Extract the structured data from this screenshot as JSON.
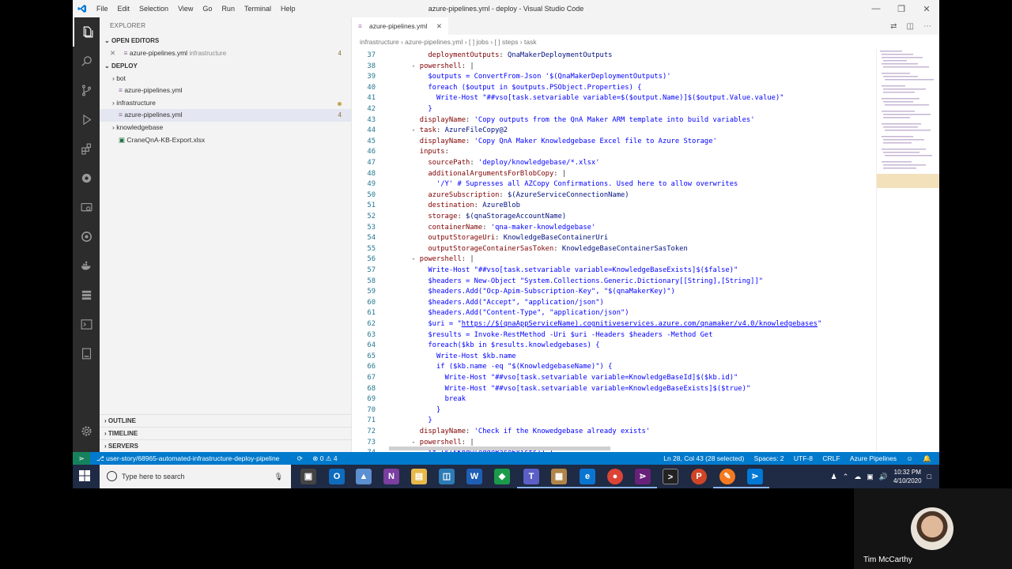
{
  "window": {
    "title": "azure-pipelines.yml - deploy - Visual Studio Code",
    "menu": [
      "File",
      "Edit",
      "Selection",
      "View",
      "Go",
      "Run",
      "Terminal",
      "Help"
    ]
  },
  "sidebar": {
    "header": "EXPLORER",
    "open_editors_label": "OPEN EDITORS",
    "open_editor": {
      "name": "azure-pipelines.yml",
      "folder": "infrastructure",
      "badge": "4"
    },
    "deploy_label": "DEPLOY",
    "tree": [
      {
        "label": "bot",
        "indent": 1,
        "kind": "folder"
      },
      {
        "label": "azure-pipelines.yml",
        "indent": 2,
        "kind": "yaml"
      },
      {
        "label": "infrastructure",
        "indent": 1,
        "kind": "folder"
      },
      {
        "label": "azure-pipelines.yml",
        "indent": 2,
        "kind": "yaml",
        "badge": "4"
      },
      {
        "label": "knowledgebase",
        "indent": 1,
        "kind": "folder"
      },
      {
        "label": "CraneQnA-KB-Export.xlsx",
        "indent": 2,
        "kind": "xlsx"
      }
    ],
    "bottom_sections": [
      "OUTLINE",
      "TIMELINE",
      "SERVERS"
    ]
  },
  "editor": {
    "tab_label": "azure-pipelines.yml",
    "breadcrumb": [
      "infrastructure",
      "azure-pipelines.yml",
      "[ ] jobs",
      "[ ] steps",
      "task"
    ],
    "lines": [
      {
        "n": "37",
        "i": "        ",
        "k": "deploymentOutputs",
        "s": ": ",
        "v": "QnaMakerDeploymentOutputs",
        "c": "t-var"
      },
      {
        "n": "38",
        "i": "    ",
        "t": "- ",
        "k": "powershell",
        "s": ": ",
        "v": "|",
        "c": "t-dark"
      },
      {
        "n": "39",
        "i": "        ",
        "v": "$outputs = ConvertFrom-Json '$(QnaMakerDeploymentOutputs)'",
        "c": "t-blue"
      },
      {
        "n": "40",
        "i": "        ",
        "v": "foreach ($output in $outputs.PSObject.Properties) {",
        "c": "t-blue"
      },
      {
        "n": "41",
        "i": "          ",
        "v": "Write-Host \"##vso[task.setvariable variable=$($output.Name)]$($output.Value.value)\"",
        "c": "t-blue"
      },
      {
        "n": "42",
        "i": "        ",
        "v": "}",
        "c": "t-blue"
      },
      {
        "n": "43",
        "i": "      ",
        "k": "displayName",
        "s": ": ",
        "v": "'Copy outputs from the QnA Maker ARM template into build variables'",
        "c": "t-blue"
      },
      {
        "n": "44",
        "i": "    ",
        "t": "- ",
        "k": "task",
        "s": ": ",
        "v": "AzureFileCopy@2",
        "c": "t-var"
      },
      {
        "n": "45",
        "i": "      ",
        "k": "displayName",
        "s": ": ",
        "v": "'Copy QnA Maker Knowledgebase Excel file to Azure Storage'",
        "c": "t-blue"
      },
      {
        "n": "46",
        "i": "      ",
        "k": "inputs",
        "s": ":",
        "v": "",
        "c": "t-blue"
      },
      {
        "n": "47",
        "i": "        ",
        "k": "sourcePath",
        "s": ": ",
        "v": "'deploy/knowledgebase/*.xlsx'",
        "c": "t-blue"
      },
      {
        "n": "48",
        "i": "        ",
        "k": "additionalArgumentsForBlobCopy",
        "s": ": ",
        "v": "|",
        "c": "t-dark"
      },
      {
        "n": "49",
        "i": "          ",
        "v": "'/Y' # Supresses all AZCopy Confirmations. Used here to allow overwrites",
        "c": "t-blue"
      },
      {
        "n": "50",
        "i": "        ",
        "k": "azureSubscription",
        "s": ": ",
        "v": "$(AzureServiceConnectionName)",
        "c": "t-var"
      },
      {
        "n": "51",
        "i": "        ",
        "k": "destination",
        "s": ": ",
        "v": "AzureBlob",
        "c": "t-var"
      },
      {
        "n": "52",
        "i": "        ",
        "k": "storage",
        "s": ": ",
        "v": "$(qnaStorageAccountName)",
        "c": "t-var"
      },
      {
        "n": "53",
        "i": "        ",
        "k": "containerName",
        "s": ": ",
        "v": "'qna-maker-knowledgebase'",
        "c": "t-blue"
      },
      {
        "n": "54",
        "i": "        ",
        "k": "outputStorageUri",
        "s": ": ",
        "v": "KnowledgeBaseContainerUri",
        "c": "t-var"
      },
      {
        "n": "55",
        "i": "        ",
        "k": "outputStorageContainerSasToken",
        "s": ": ",
        "v": "KnowledgeBaseContainerSasToken",
        "c": "t-var"
      },
      {
        "n": "56",
        "i": "    ",
        "t": "- ",
        "k": "powershell",
        "s": ": ",
        "v": "|",
        "c": "t-dark"
      },
      {
        "n": "57",
        "i": "        ",
        "v": "Write-Host \"##vso[task.setvariable variable=KnowledgeBaseExists]$($false)\"",
        "c": "t-blue"
      },
      {
        "n": "58",
        "i": "        ",
        "v": "$headers = New-Object \"System.Collections.Generic.Dictionary[[String],[String]]\"",
        "c": "t-blue"
      },
      {
        "n": "59",
        "i": "        ",
        "v": "$headers.Add(\"Ocp-Apim-Subscription-Key\", \"$(qnaMakerKey)\")",
        "c": "t-blue"
      },
      {
        "n": "60",
        "i": "        ",
        "v": "$headers.Add(\"Accept\", \"application/json\")",
        "c": "t-blue"
      },
      {
        "n": "61",
        "i": "        ",
        "v": "$headers.Add(\"Content-Type\", \"application/json\")",
        "c": "t-blue"
      },
      {
        "n": "62",
        "i": "        ",
        "v": "$uri = \"",
        "u": "https://$(qnaAppServiceName).cognitiveservices.azure.com/qnamaker/v4.0/knowledgebases",
        "e": "\"",
        "c": "t-blue"
      },
      {
        "n": "63",
        "i": "        ",
        "v": "$results = Invoke-RestMethod -Uri $uri -Headers $headers -Method Get",
        "c": "t-blue"
      },
      {
        "n": "64",
        "i": "        ",
        "v": "foreach($kb in $results.knowledgebases) {",
        "c": "t-blue"
      },
      {
        "n": "65",
        "i": "          ",
        "v": "Write-Host $kb.name",
        "c": "t-blue"
      },
      {
        "n": "66",
        "i": "          ",
        "v": "if ($kb.name -eq \"$(KnowledgebaseName)\") {",
        "c": "t-blue"
      },
      {
        "n": "67",
        "i": "            ",
        "v": "Write-Host \"##vso[task.setvariable variable=KnowledgeBaseId]$($kb.id)\"",
        "c": "t-blue"
      },
      {
        "n": "68",
        "i": "            ",
        "v": "Write-Host \"##vso[task.setvariable variable=KnowledgeBaseExists]$($true)\"",
        "c": "t-blue"
      },
      {
        "n": "69",
        "i": "            ",
        "v": "break",
        "c": "t-blue"
      },
      {
        "n": "70",
        "i": "          ",
        "v": "}",
        "c": "t-blue"
      },
      {
        "n": "71",
        "i": "        ",
        "v": "}",
        "c": "t-blue"
      },
      {
        "n": "72",
        "i": "      ",
        "k": "displayName",
        "s": ": ",
        "v": "'Check if the Knowedgebase already exists'",
        "c": "t-blue"
      },
      {
        "n": "73",
        "i": "    ",
        "t": "- ",
        "k": "powershell",
        "s": ": ",
        "v": "|",
        "c": "t-dark"
      },
      {
        "n": "74",
        "i": "        ",
        "v": "if ($($KnowledgeBaseExists)) {",
        "c": "t-blue"
      }
    ]
  },
  "statusbar": {
    "branch": "user-story/68965-automated-infrastructure-deploy-pipeline",
    "problems": "⊗ 0 ⚠ 4",
    "position": "Ln 28, Col 43 (28 selected)",
    "spaces": "Spaces: 2",
    "encoding": "UTF-8",
    "eol": "CRLF",
    "language": "Azure Pipelines"
  },
  "taskbar": {
    "search_placeholder": "Type here to search",
    "time": "10:32 PM",
    "date": "4/10/2020"
  },
  "webcam": {
    "name": "Tim McCarthy"
  },
  "colors": {
    "accent": "#007acc",
    "activity": "#2c2c2c",
    "remote": "#16825d"
  }
}
